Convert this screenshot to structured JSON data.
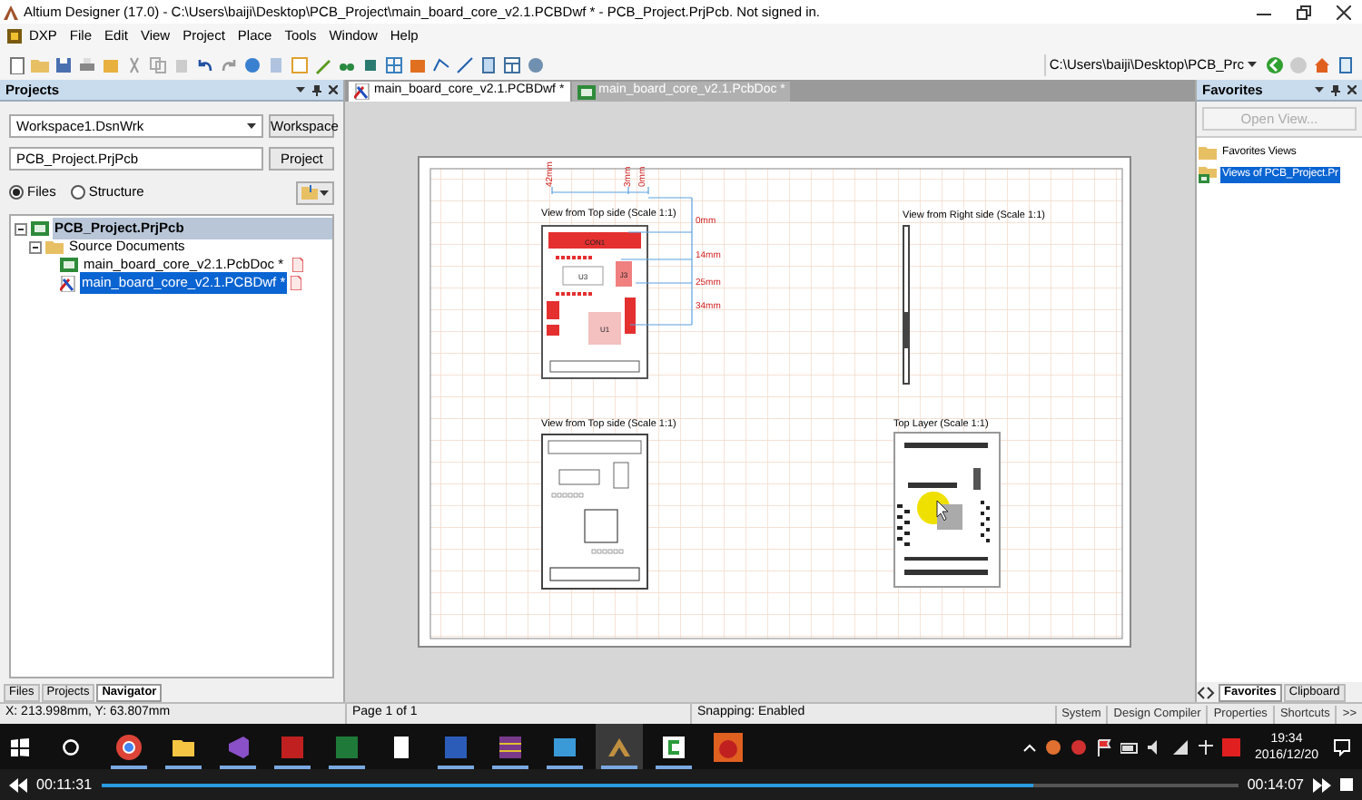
{
  "window": {
    "title": "Altium Designer (17.0) - C:\\Users\\baiji\\Desktop\\PCB_Project\\main_board_core_v2.1.PCBDwf * - PCB_Project.PrjPcb. Not signed in."
  },
  "menu": [
    "DXP",
    "File",
    "Edit",
    "View",
    "Project",
    "Place",
    "Tools",
    "Window",
    "Help"
  ],
  "toolbar": {
    "path": "C:\\Users\\baiji\\Desktop\\PCB_Prc"
  },
  "projects_panel": {
    "title": "Projects",
    "workspace": "Workspace1.DsnWrk",
    "workspace_button": "Workspace",
    "project": "PCB_Project.PrjPcb",
    "project_button": "Project",
    "view_options": [
      {
        "label": "Files",
        "selected": true
      },
      {
        "label": "Structure",
        "selected": false
      }
    ],
    "tree": [
      {
        "label": "PCB_Project.PrjPcb",
        "kind": "project",
        "selected": false,
        "expanded": true,
        "children": [
          {
            "label": "Source Documents",
            "kind": "folder",
            "selected": false,
            "expanded": true,
            "children": [
              {
                "label": "main_board_core_v2.1.PcbDoc *",
                "kind": "pcb",
                "selected": false
              },
              {
                "label": "main_board_core_v2.1.PCBDwf *",
                "kind": "drawing",
                "selected": true
              }
            ]
          }
        ]
      }
    ],
    "tabs": [
      {
        "label": "Files",
        "selected": false
      },
      {
        "label": "Projects",
        "selected": false
      },
      {
        "label": "Navigator",
        "selected": true
      }
    ]
  },
  "document_tabs": [
    {
      "label": "main_board_core_v2.1.PCBDwf *",
      "kind": "drawing",
      "selected": true
    },
    {
      "label": "main_board_core_v2.1.PcbDoc *",
      "kind": "pcb",
      "selected": false
    }
  ],
  "canvas": {
    "views": [
      {
        "kind": "top_dimensioned",
        "title": "View from Top side (Scale 1:1)",
        "labels": [
          "CON1",
          "U3",
          "J3",
          "U1"
        ],
        "dimension_labels": [
          "0mm",
          "14mm",
          "25mm",
          "34mm"
        ],
        "rotated_labels": [
          "42mm",
          "3mm",
          "0mm"
        ]
      },
      {
        "kind": "right_side",
        "title": "View from Right side (Scale 1:1)"
      },
      {
        "kind": "top_plain",
        "title": "View from Top side (Scale 1:1)"
      },
      {
        "kind": "top_layer",
        "title": "Top Layer (Scale 1:1)"
      }
    ]
  },
  "favorites_panel": {
    "title": "Favorites",
    "open_button": {
      "label": "Open View...",
      "disabled": true
    },
    "tree": [
      {
        "label": "Favorites Views",
        "kind": "folder",
        "selected": false
      },
      {
        "label": "Views of PCB_Project.Pr",
        "kind": "views",
        "selected": true
      }
    ],
    "tabs": [
      {
        "label": "Favorites",
        "selected": true
      },
      {
        "label": "Clipboard",
        "selected": false
      }
    ]
  },
  "status_bar": {
    "coordinates": "X: 213.998mm, Y: 63.807mm",
    "page": "Page 1 of 1",
    "snapping": "Snapping: Enabled",
    "buttons": [
      "System",
      "Design Compiler",
      "Properties",
      "Shortcuts",
      ">>"
    ]
  },
  "taskbar": {
    "apps": [
      {
        "kind": "browser",
        "running": true
      },
      {
        "kind": "folder",
        "running": true
      },
      {
        "kind": "studio",
        "running": true
      },
      {
        "kind": "pdf",
        "running": true
      },
      {
        "kind": "sheet",
        "running": true
      },
      {
        "kind": "calculator",
        "running": false
      },
      {
        "kind": "document",
        "running": true
      },
      {
        "kind": "archive",
        "running": true
      },
      {
        "kind": "viewer",
        "running": true
      },
      {
        "kind": "altium",
        "running": true
      },
      {
        "kind": "recorder",
        "running": true
      },
      {
        "kind": "game",
        "running": false
      }
    ],
    "time": "19:34",
    "date": "2016/12/20"
  },
  "player": {
    "elapsed": "00:11:31",
    "total": "00:14:07",
    "level": 0.82
  }
}
